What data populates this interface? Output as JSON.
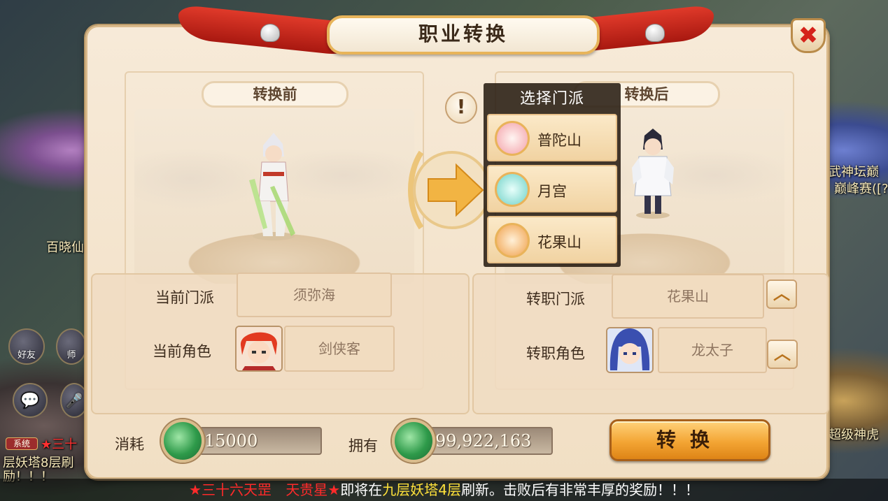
{
  "background": {
    "left_texts": [
      "百晓仙",
      "层妖塔8层刷",
      "励！！！"
    ],
    "right_texts": [
      "武神坛巅",
      "巅峰赛([?]",
      "超级神虎"
    ],
    "sys_tag": "系统",
    "sys_text": "★三十",
    "buttons": {
      "friends": "好友",
      "master": "师"
    }
  },
  "panel": {
    "title": "职业转换",
    "close_symbol": "✖",
    "before_label": "转换前",
    "after_label": "转换后",
    "info_symbol": "!"
  },
  "dropdown": {
    "title": "选择门派",
    "options": [
      {
        "name": "普陀山",
        "icon": "lotus-icon",
        "color": "#f3a0a8"
      },
      {
        "name": "月宫",
        "icon": "moon-palace-icon",
        "color": "#6fd1c7"
      },
      {
        "name": "花果山",
        "icon": "monkey-staff-icon",
        "color": "#f0a04a"
      }
    ]
  },
  "current": {
    "sect_label": "当前门派",
    "sect_value": "须弥海",
    "role_label": "当前角色",
    "role_value": "剑侠客"
  },
  "target": {
    "sect_label": "转职门派",
    "sect_value": "花果山",
    "role_label": "转职角色",
    "role_value": "龙太子",
    "up_symbol": "︿"
  },
  "cost": {
    "consume_label": "消耗",
    "consume_value": "15000",
    "own_label": "拥有",
    "own_value": "99,922,163"
  },
  "convert_button": "转换",
  "marquee": {
    "part1": "★三十六天罡",
    "part2": "天贵星★",
    "part3": "即将在",
    "part4": "九层妖塔4层",
    "part5": "刷新。击败后有非常丰厚的奖励！！！"
  }
}
